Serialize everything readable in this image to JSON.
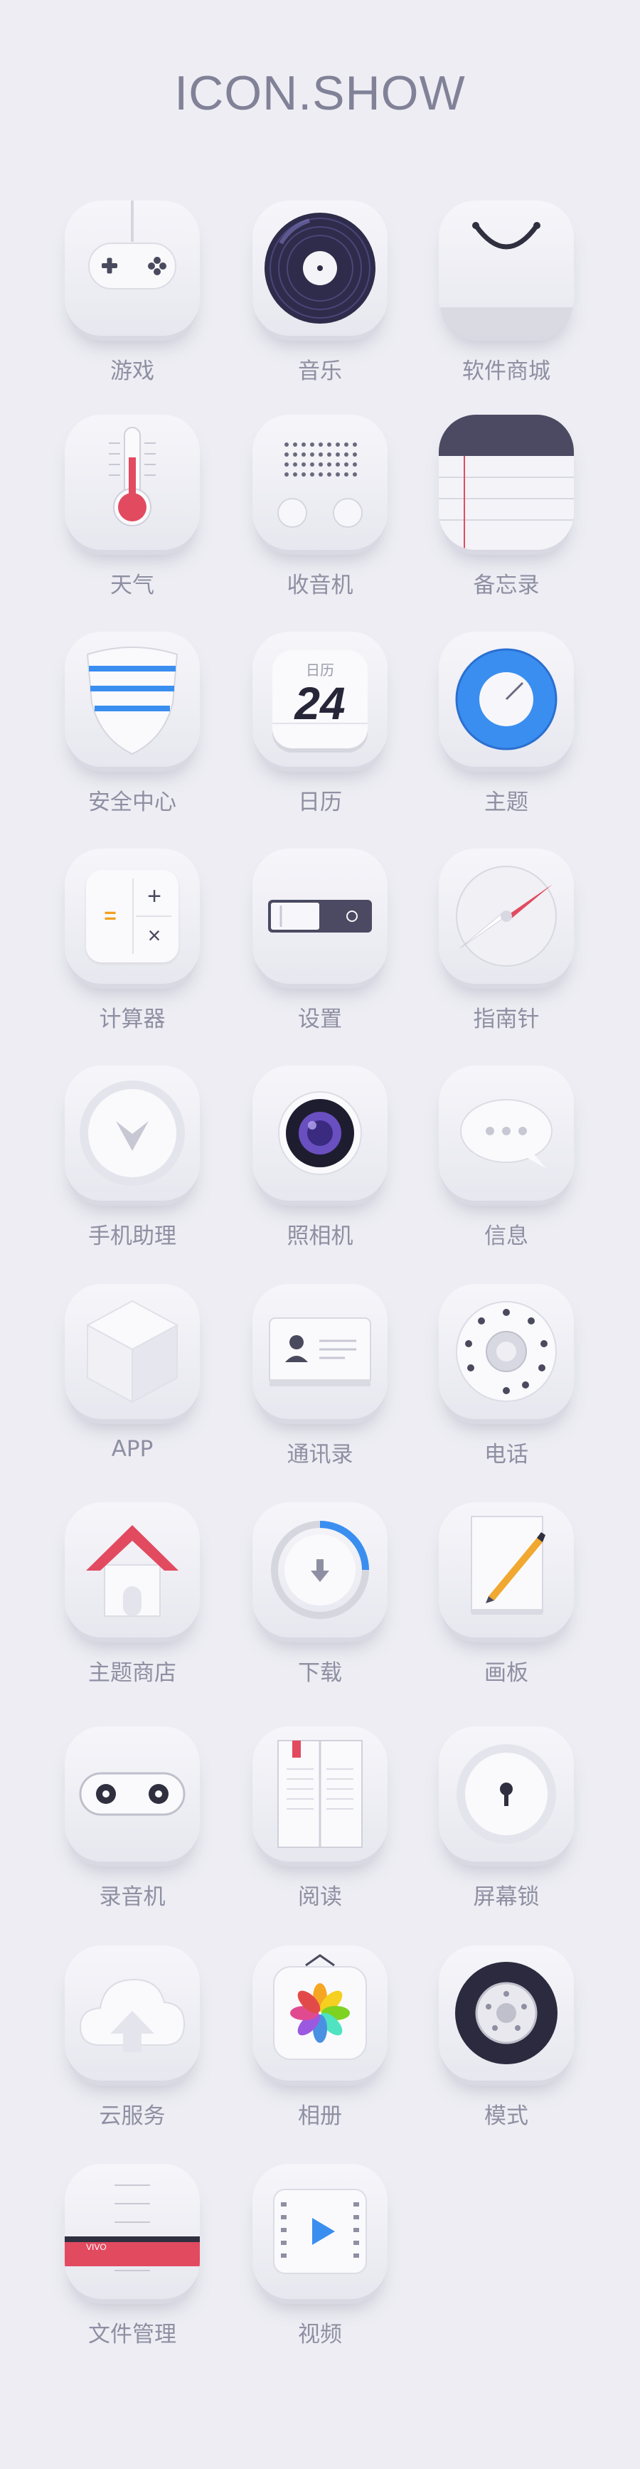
{
  "page": {
    "title": "ICON.SHOW"
  },
  "icons": [
    {
      "label": "游戏",
      "icon": "gamepad-icon"
    },
    {
      "label": "音乐",
      "icon": "vinyl-record-icon"
    },
    {
      "label": "软件商城",
      "icon": "shopping-bag-icon"
    },
    {
      "label": "天气",
      "icon": "thermometer-icon"
    },
    {
      "label": "收音机",
      "icon": "radio-icon"
    },
    {
      "label": "备忘录",
      "icon": "notepad-icon"
    },
    {
      "label": "安全中心",
      "icon": "shield-icon"
    },
    {
      "label": "日历",
      "icon": "calendar-icon",
      "calendar_month": "日历",
      "calendar_day": "24"
    },
    {
      "label": "主题",
      "icon": "theme-dial-icon"
    },
    {
      "label": "计算器",
      "icon": "calculator-icon",
      "keys": [
        "=",
        "+",
        "×"
      ]
    },
    {
      "label": "设置",
      "icon": "toggle-switch-icon"
    },
    {
      "label": "指南针",
      "icon": "compass-icon"
    },
    {
      "label": "手机助理",
      "icon": "assistant-v-icon"
    },
    {
      "label": "照相机",
      "icon": "camera-lens-icon"
    },
    {
      "label": "信息",
      "icon": "chat-bubble-icon"
    },
    {
      "label": "APP",
      "icon": "cube-icon"
    },
    {
      "label": "通讯录",
      "icon": "contact-card-icon"
    },
    {
      "label": "电话",
      "icon": "rotary-dial-icon"
    },
    {
      "label": "主题商店",
      "icon": "house-icon"
    },
    {
      "label": "下载",
      "icon": "download-icon"
    },
    {
      "label": "画板",
      "icon": "drawing-pad-icon"
    },
    {
      "label": "录音机",
      "icon": "cassette-icon"
    },
    {
      "label": "阅读",
      "icon": "open-book-icon"
    },
    {
      "label": "屏幕锁",
      "icon": "keyhole-lock-icon"
    },
    {
      "label": "云服务",
      "icon": "cloud-upload-icon"
    },
    {
      "label": "相册",
      "icon": "photo-flower-icon"
    },
    {
      "label": "模式",
      "icon": "wheel-icon"
    },
    {
      "label": "文件管理",
      "icon": "file-folder-icon",
      "tag_text": "VIVO"
    },
    {
      "label": "视频",
      "icon": "video-film-icon"
    }
  ],
  "colors": {
    "background": "#ededf3",
    "title": "#818198",
    "label": "#8f8fa3",
    "accent_blue": "#3a8ef0",
    "accent_red": "#e24a60",
    "dark_purple": "#3a3858"
  }
}
